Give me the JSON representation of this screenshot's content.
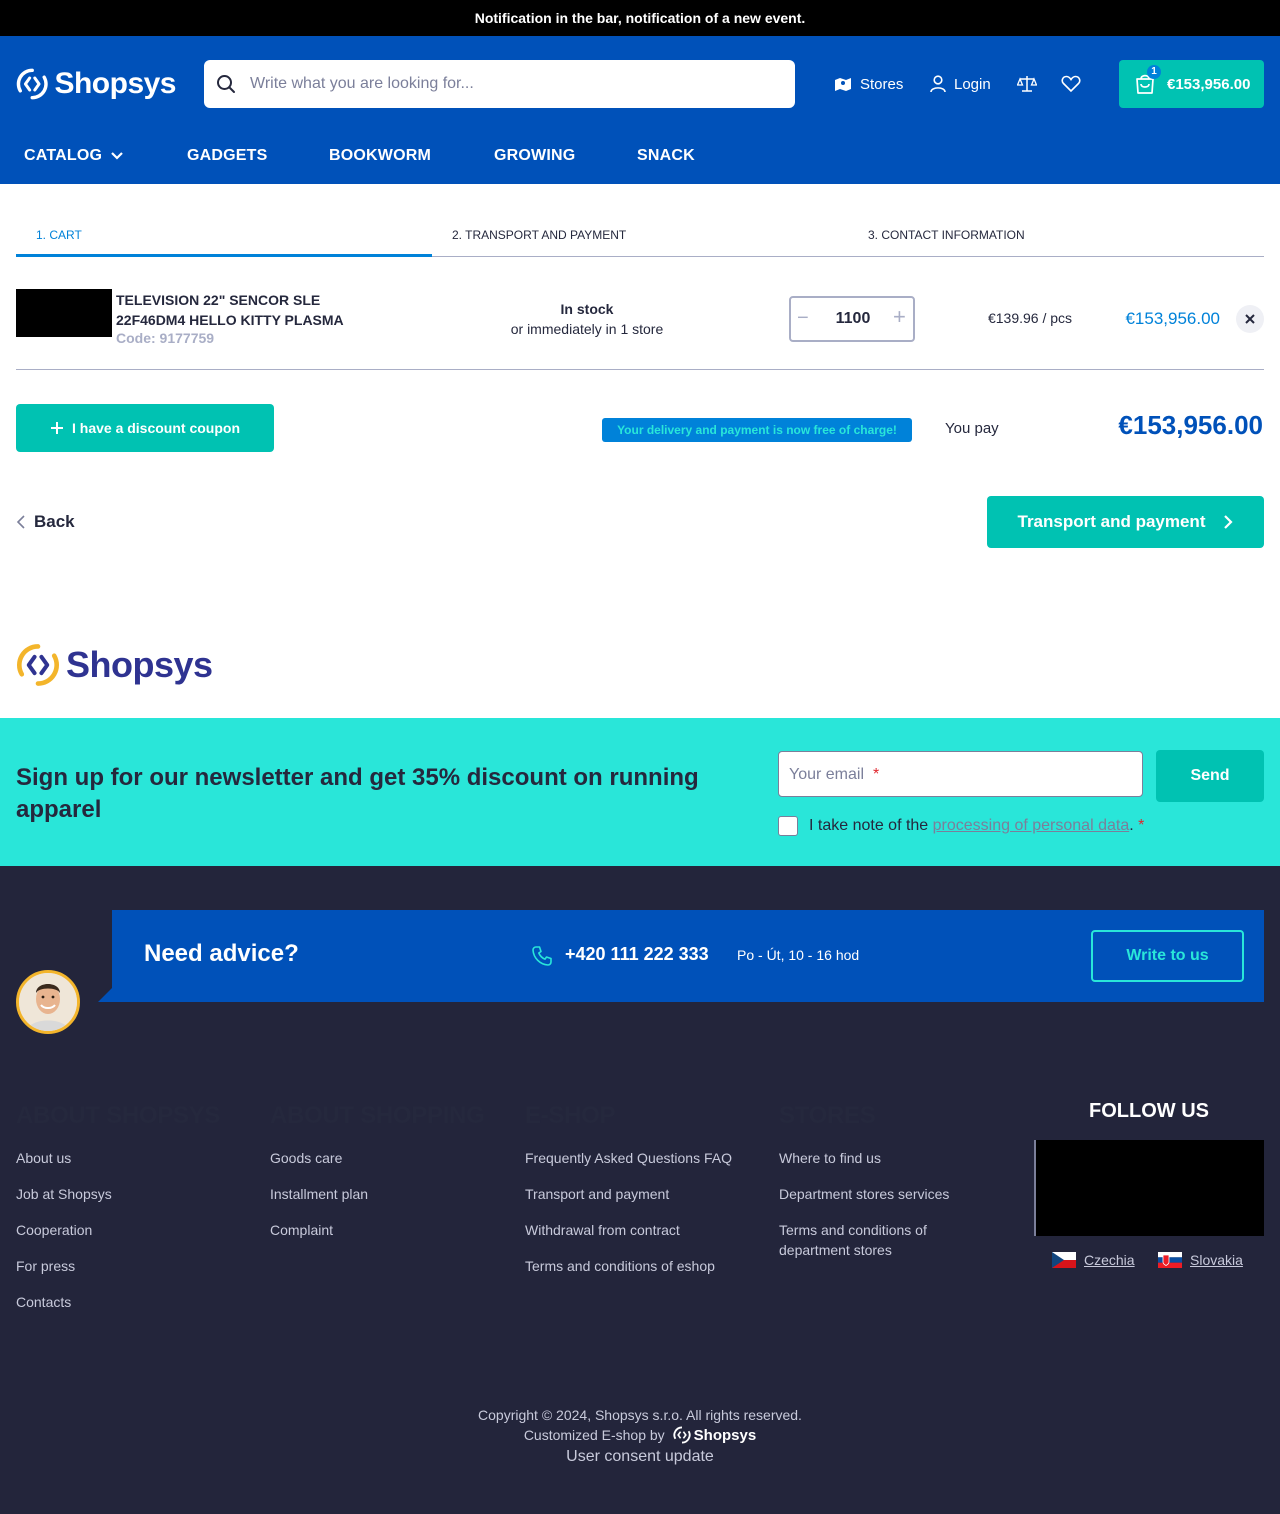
{
  "notification": "Notification in the bar, notification of a new event.",
  "header": {
    "logo_text": "Shopsys",
    "search_placeholder": "Write what you are looking for...",
    "stores_label": "Stores",
    "login_label": "Login",
    "cart_count": "1",
    "cart_total": "€153,956.00"
  },
  "nav": {
    "items": [
      "CATALOG",
      "GADGETS",
      "BOOKWORM",
      "GROWING",
      "SNACK"
    ]
  },
  "steps": [
    "1. CART",
    "2. TRANSPORT AND PAYMENT",
    "3. CONTACT INFORMATION"
  ],
  "cart": {
    "product_name": "TELEVISION 22\" SENCOR SLE 22F46DM4 HELLO KITTY PLASMA",
    "product_code": "Code: 9177759",
    "availability": "In stock",
    "availability_sub": "or immediately in 1 store",
    "quantity": "1100",
    "unit_price": "€139.96 / pcs",
    "line_total": "€153,956.00"
  },
  "summary": {
    "coupon_label": "I have a discount coupon",
    "free_delivery": "Your delivery and payment is now free of charge!",
    "you_pay_label": "You pay",
    "you_pay_value": "€153,956.00"
  },
  "actions": {
    "back_label": "Back",
    "next_label": "Transport and payment"
  },
  "brand_logo_text": "Shopsys",
  "newsletter": {
    "title": "Sign up for our newsletter and get 35% discount on running apparel",
    "email_placeholder": "Your email",
    "required_mark": "*",
    "send_label": "Send",
    "consent_prefix": "I take note of the ",
    "consent_link": "processing of personal data",
    "consent_suffix": "."
  },
  "advice": {
    "title": "Need advice?",
    "phone": "+420 111 222 333",
    "hours": "Po - Út, 10 - 16 hod",
    "write_label": "Write to us"
  },
  "footer": {
    "columns": [
      {
        "title": "ABOUT SHOPSYS",
        "links": [
          "About us",
          "Job at Shopsys",
          "Cooperation",
          "For press",
          "Contacts"
        ]
      },
      {
        "title": "ABOUT SHOPPING",
        "links": [
          "Goods care",
          "Installment plan",
          "Complaint"
        ]
      },
      {
        "title": "E-SHOP",
        "links": [
          "Frequently Asked Questions FAQ",
          "Transport and payment",
          "Withdrawal from contract",
          "Terms and conditions of eshop"
        ]
      },
      {
        "title": "STORES",
        "links": [
          "Where to find us",
          "Department stores services",
          "Terms and conditions of department stores"
        ]
      }
    ],
    "follow_title": "FOLLOW US",
    "languages": [
      "Czechia",
      "Slovakia"
    ],
    "copyright": "Copyright © 2024, Shopsys s.r.o. All rights reserved.",
    "customized": "Customized E-shop by",
    "customized_logo": "Shopsys",
    "consent_update": "User consent update"
  },
  "colors": {
    "primary_blue": "#0051b9",
    "teal": "#00c2b2",
    "newsletter_bg": "#29e6d9",
    "footer_bg": "#23253b",
    "accent_blue": "#0082d9"
  }
}
